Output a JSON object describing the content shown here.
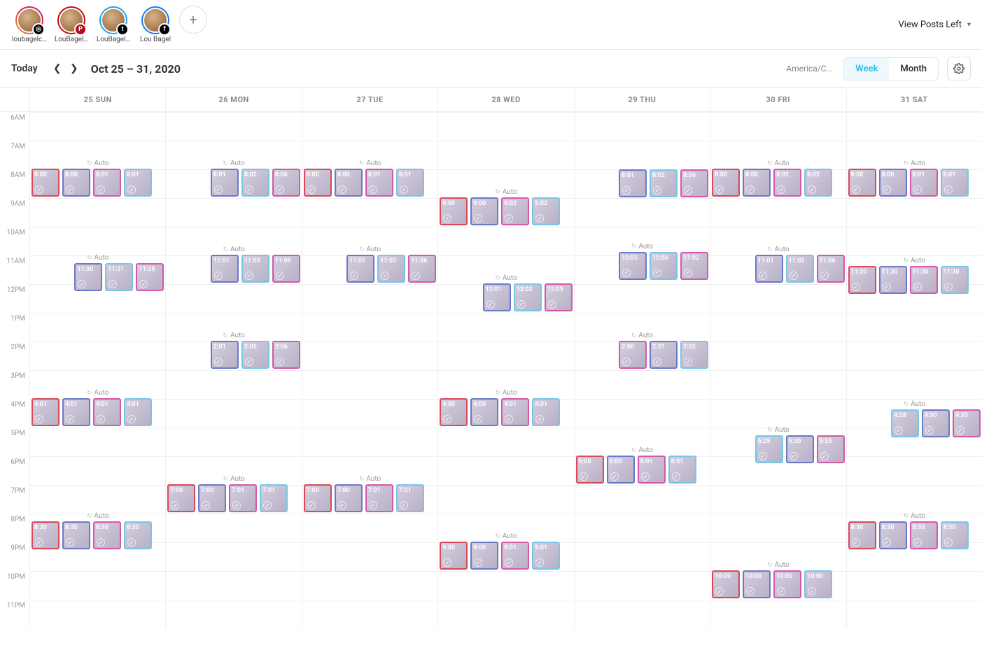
{
  "header": {
    "accounts": [
      {
        "name": "loubagelc…",
        "platform": "ig"
      },
      {
        "name": "LouBagel…",
        "platform": "pin"
      },
      {
        "name": "LouBagel…",
        "platform": "tw"
      },
      {
        "name": "Lou Bagel",
        "platform": "fb"
      }
    ],
    "view_posts_left": "View Posts Left"
  },
  "toolbar": {
    "today": "Today",
    "date_range": "Oct 25 – 31, 2020",
    "timezone": "America/Chi…",
    "view_week": "Week",
    "view_month": "Month"
  },
  "days": [
    "25 SUN",
    "26 MON",
    "27 TUE",
    "28 WED",
    "29 THU",
    "30 FRI",
    "31 SAT"
  ],
  "hours": [
    "6AM",
    "7AM",
    "8AM",
    "9AM",
    "10AM",
    "11AM",
    "12PM",
    "1PM",
    "2PM",
    "3PM",
    "4PM",
    "5PM",
    "6PM",
    "7PM",
    "8PM",
    "9PM",
    "10PM",
    "11PM"
  ],
  "auto_label": "Auto",
  "schedule": [
    {
      "day": 0,
      "row": 2,
      "auto": true,
      "posts": [
        {
          "time": "8:00",
          "c": "red"
        },
        {
          "time": "8:00",
          "c": "blue"
        },
        {
          "time": "8:01",
          "c": "pink"
        },
        {
          "time": "8:01",
          "c": "lightblue"
        }
      ]
    },
    {
      "day": 0,
      "row": 5.3,
      "auto": true,
      "posts": [
        {
          "time": "11:30",
          "c": "blue"
        },
        {
          "time": "11:31",
          "c": "lightblue"
        },
        {
          "time": "11:35",
          "c": "pink"
        }
      ]
    },
    {
      "day": 0,
      "row": 10,
      "auto": true,
      "posts": [
        {
          "time": "4:01",
          "c": "red"
        },
        {
          "time": "4:01",
          "c": "blue"
        },
        {
          "time": "4:01",
          "c": "pink"
        },
        {
          "time": "4:01",
          "c": "lightblue"
        }
      ]
    },
    {
      "day": 0,
      "row": 14.3,
      "auto": true,
      "posts": [
        {
          "time": "8:30",
          "c": "red"
        },
        {
          "time": "8:30",
          "c": "blue"
        },
        {
          "time": "8:30",
          "c": "pink"
        },
        {
          "time": "8:30",
          "c": "lightblue"
        }
      ]
    },
    {
      "day": 1,
      "row": 2,
      "auto": true,
      "posts": [
        {
          "time": "8:01",
          "c": "blue"
        },
        {
          "time": "8:02",
          "c": "lightblue"
        },
        {
          "time": "8:06",
          "c": "pink"
        }
      ]
    },
    {
      "day": 1,
      "row": 5,
      "auto": true,
      "posts": [
        {
          "time": "11:01",
          "c": "blue"
        },
        {
          "time": "11:03",
          "c": "lightblue"
        },
        {
          "time": "11:06",
          "c": "pink"
        }
      ]
    },
    {
      "day": 1,
      "row": 8,
      "auto": true,
      "posts": [
        {
          "time": "2:01",
          "c": "blue"
        },
        {
          "time": "2:05",
          "c": "lightblue"
        },
        {
          "time": "2:06",
          "c": "pink"
        }
      ]
    },
    {
      "day": 1,
      "row": 13,
      "auto": true,
      "posts": [
        {
          "time": "7:00",
          "c": "red"
        },
        {
          "time": "7:00",
          "c": "blue"
        },
        {
          "time": "7:01",
          "c": "pink"
        },
        {
          "time": "7:01",
          "c": "lightblue"
        }
      ]
    },
    {
      "day": 2,
      "row": 2,
      "auto": true,
      "posts": [
        {
          "time": "8:00",
          "c": "red"
        },
        {
          "time": "8:00",
          "c": "blue"
        },
        {
          "time": "8:01",
          "c": "pink"
        },
        {
          "time": "8:01",
          "c": "lightblue"
        }
      ]
    },
    {
      "day": 2,
      "row": 5,
      "auto": true,
      "posts": [
        {
          "time": "11:01",
          "c": "blue"
        },
        {
          "time": "11:03",
          "c": "lightblue"
        },
        {
          "time": "11:06",
          "c": "pink"
        }
      ]
    },
    {
      "day": 2,
      "row": 13,
      "auto": true,
      "posts": [
        {
          "time": "7:00",
          "c": "red"
        },
        {
          "time": "7:00",
          "c": "blue"
        },
        {
          "time": "7:01",
          "c": "pink"
        },
        {
          "time": "7:01",
          "c": "lightblue"
        }
      ]
    },
    {
      "day": 3,
      "row": 3,
      "auto": true,
      "posts": [
        {
          "time": "9:00",
          "c": "red"
        },
        {
          "time": "9:00",
          "c": "blue"
        },
        {
          "time": "9:02",
          "c": "pink"
        },
        {
          "time": "9:02",
          "c": "lightblue"
        }
      ]
    },
    {
      "day": 3,
      "row": 6,
      "auto": true,
      "posts": [
        {
          "time": "12:01",
          "c": "blue"
        },
        {
          "time": "12:02",
          "c": "lightblue"
        },
        {
          "time": "12:05",
          "c": "pink"
        }
      ]
    },
    {
      "day": 3,
      "row": 10,
      "auto": true,
      "posts": [
        {
          "time": "4:00",
          "c": "red"
        },
        {
          "time": "4:00",
          "c": "blue"
        },
        {
          "time": "4:01",
          "c": "pink"
        },
        {
          "time": "4:01",
          "c": "lightblue"
        }
      ]
    },
    {
      "day": 3,
      "row": 15,
      "auto": true,
      "posts": [
        {
          "time": "9:00",
          "c": "red"
        },
        {
          "time": "9:00",
          "c": "blue"
        },
        {
          "time": "9:01",
          "c": "pink"
        },
        {
          "time": "9:01",
          "c": "lightblue"
        }
      ]
    },
    {
      "day": 4,
      "row": 2,
      "auto": false,
      "posts": [
        {
          "time": "8:01",
          "c": "blue"
        },
        {
          "time": "8:02",
          "c": "lightblue"
        },
        {
          "time": "8:06",
          "c": "pink"
        }
      ]
    },
    {
      "day": 4,
      "row": 4.9,
      "auto": true,
      "posts": [
        {
          "time": "10:55",
          "c": "blue"
        },
        {
          "time": "10:56",
          "c": "lightblue"
        },
        {
          "time": "11:02",
          "c": "pink"
        }
      ]
    },
    {
      "day": 4,
      "row": 8,
      "auto": true,
      "posts": [
        {
          "time": "2:00",
          "c": "pink"
        },
        {
          "time": "2:01",
          "c": "blue"
        },
        {
          "time": "2:02",
          "c": "lightblue"
        }
      ]
    },
    {
      "day": 4,
      "row": 12,
      "auto": true,
      "posts": [
        {
          "time": "6:00",
          "c": "red"
        },
        {
          "time": "6:00",
          "c": "blue"
        },
        {
          "time": "6:01",
          "c": "pink"
        },
        {
          "time": "6:01",
          "c": "lightblue"
        }
      ]
    },
    {
      "day": 5,
      "row": 2,
      "auto": true,
      "posts": [
        {
          "time": "8:00",
          "c": "red"
        },
        {
          "time": "8:00",
          "c": "blue"
        },
        {
          "time": "8:02",
          "c": "pink"
        },
        {
          "time": "8:02",
          "c": "lightblue"
        }
      ]
    },
    {
      "day": 5,
      "row": 5,
      "auto": true,
      "posts": [
        {
          "time": "11:01",
          "c": "blue"
        },
        {
          "time": "11:02",
          "c": "lightblue"
        },
        {
          "time": "11:06",
          "c": "pink"
        }
      ]
    },
    {
      "day": 5,
      "row": 11.3,
      "auto": true,
      "posts": [
        {
          "time": "5:25",
          "c": "lightblue"
        },
        {
          "time": "5:30",
          "c": "blue"
        },
        {
          "time": "5:35",
          "c": "pink"
        }
      ]
    },
    {
      "day": 5,
      "row": 16,
      "auto": true,
      "posts": [
        {
          "time": "10:00",
          "c": "red"
        },
        {
          "time": "10:00",
          "c": "blue"
        },
        {
          "time": "10:00",
          "c": "pink"
        },
        {
          "time": "10:00",
          "c": "lightblue"
        }
      ]
    },
    {
      "day": 6,
      "row": 2,
      "auto": true,
      "posts": [
        {
          "time": "8:00",
          "c": "red"
        },
        {
          "time": "8:00",
          "c": "blue"
        },
        {
          "time": "8:01",
          "c": "pink"
        },
        {
          "time": "8:01",
          "c": "lightblue"
        }
      ]
    },
    {
      "day": 6,
      "row": 5.4,
      "auto": true,
      "posts": [
        {
          "time": "11:30",
          "c": "red"
        },
        {
          "time": "11:30",
          "c": "blue"
        },
        {
          "time": "11:30",
          "c": "pink"
        },
        {
          "time": "11:30",
          "c": "lightblue"
        }
      ]
    },
    {
      "day": 6,
      "row": 10.4,
      "auto": true,
      "posts": [
        {
          "time": "4:28",
          "c": "lightblue"
        },
        {
          "time": "4:30",
          "c": "blue"
        },
        {
          "time": "4:35",
          "c": "pink"
        }
      ]
    },
    {
      "day": 6,
      "row": 14.3,
      "auto": true,
      "posts": [
        {
          "time": "8:30",
          "c": "red"
        },
        {
          "time": "8:30",
          "c": "blue"
        },
        {
          "time": "8:30",
          "c": "pink"
        },
        {
          "time": "8:30",
          "c": "lightblue"
        }
      ]
    }
  ]
}
